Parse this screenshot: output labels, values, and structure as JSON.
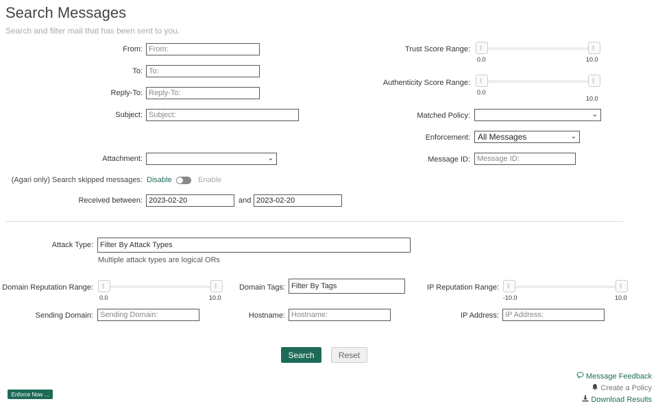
{
  "header": {
    "title": "Search Messages",
    "subtitle": "Search and filter mail that has been sent to you."
  },
  "form": {
    "from": {
      "label": "From:",
      "placeholder": "From:"
    },
    "to": {
      "label": "To:",
      "placeholder": "To:"
    },
    "reply_to": {
      "label": "Reply-To:",
      "placeholder": "Reply-To:"
    },
    "subject": {
      "label": "Subject:",
      "placeholder": "Subject:"
    },
    "attachment": {
      "label": "Attachment:",
      "value": ""
    },
    "skipped": {
      "prefix": "(Agari only) Search skipped messages:",
      "disable": "Disable",
      "enable": "Enable"
    },
    "received": {
      "label": "Received between:",
      "start": "2023-02-20",
      "and": "and",
      "end": "2023-02-20"
    },
    "trust_score": {
      "label": "Trust Score Range:",
      "min": "0.0",
      "max": "10.0"
    },
    "authenticity_score": {
      "label": "Authenticity Score Range:",
      "min": "0.0",
      "max": "10.0"
    },
    "matched_policy": {
      "label": "Matched Policy:",
      "value": ""
    },
    "enforcement": {
      "label": "Enforcement:",
      "value": "All Messages"
    },
    "message_id": {
      "label": "Message ID:",
      "placeholder": "Message ID:"
    }
  },
  "advanced": {
    "attack_type": {
      "label": "Attack Type:",
      "value": "Filter By Attack Types",
      "hint": "Multiple attack types are logical ORs"
    },
    "domain_reputation": {
      "label": "Domain Reputation Range:",
      "min": "0.0",
      "max": "10.0"
    },
    "domain_tags": {
      "label": "Domain Tags:",
      "value": "Filter By Tags"
    },
    "ip_reputation": {
      "label": "IP Reputation Range:",
      "min": "-10.0",
      "max": "10.0"
    },
    "sending_domain": {
      "label": "Sending Domain:",
      "placeholder": "Sending Domain:"
    },
    "hostname": {
      "label": "Hostname:",
      "placeholder": "Hostname:"
    },
    "ip_address": {
      "label": "IP Address:",
      "placeholder": "IP Address:"
    }
  },
  "actions": {
    "search": "Search",
    "reset": "Reset",
    "enforce_now": "Enforce Now ...",
    "message_feedback": "Message Feedback",
    "create_policy": "Create a Policy",
    "download_results": "Download Results"
  },
  "icons": {
    "message_feedback": "speech-bubble-icon",
    "create_policy": "bell-icon",
    "download_results": "download-icon"
  },
  "colors": {
    "accent": "#1d6b57"
  }
}
